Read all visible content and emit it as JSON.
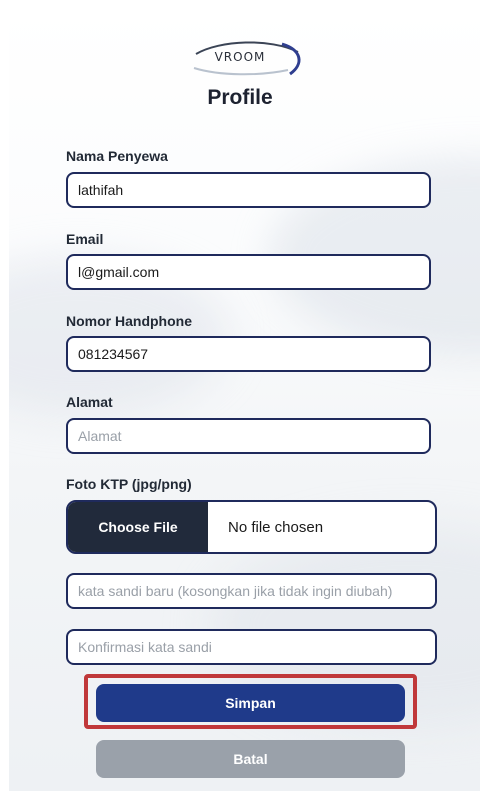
{
  "brand": {
    "logo_text": "VROOM"
  },
  "page": {
    "title": "Profile"
  },
  "form": {
    "nama": {
      "label": "Nama Penyewa",
      "value": "lathifah"
    },
    "email": {
      "label": "Email",
      "value": "l@gmail.com"
    },
    "phone": {
      "label": "Nomor Handphone",
      "value": "081234567"
    },
    "alamat": {
      "label": "Alamat",
      "placeholder": "Alamat"
    },
    "ktp": {
      "label": "Foto KTP (jpg/png)",
      "button_label": "Choose File",
      "status": "No file chosen"
    },
    "password": {
      "placeholder": "kata sandi baru (kosongkan jika tidak ingin diubah)"
    },
    "confirm_password": {
      "placeholder": "Konfirmasi kata sandi"
    }
  },
  "actions": {
    "save_label": "Simpan",
    "cancel_label": "Batal"
  },
  "colors": {
    "primary": "#1f3a8a",
    "input_border": "#1f2a5c",
    "highlight": "#c0383a",
    "cancel": "#9aa1aa",
    "file_button": "#212a3b"
  }
}
